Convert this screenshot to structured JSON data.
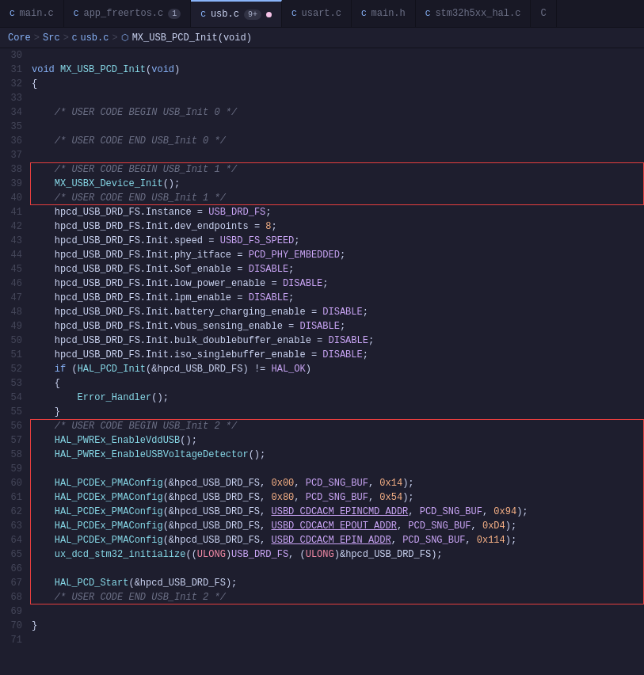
{
  "tabs": [
    {
      "id": "main-c",
      "label": "main.c",
      "icon": "C",
      "active": false,
      "badge": null,
      "dot": false
    },
    {
      "id": "app-freertos-c",
      "label": "app_freertos.c",
      "icon": "C",
      "active": false,
      "badge": "1",
      "dot": false
    },
    {
      "id": "usb-c",
      "label": "usb.c",
      "icon": "C",
      "active": true,
      "badge": "9+",
      "dot": true
    },
    {
      "id": "usart-c",
      "label": "usart.c",
      "icon": "C",
      "active": false,
      "badge": null,
      "dot": false
    },
    {
      "id": "main-h",
      "label": "main.h",
      "icon": "C",
      "active": false,
      "badge": null,
      "dot": false
    },
    {
      "id": "stm32h5xx-hal-c",
      "label": "stm32h5xx_hal.c",
      "icon": "C",
      "active": false,
      "badge": null,
      "dot": false
    }
  ],
  "breadcrumb": {
    "parts": [
      "Core",
      "Src",
      "usb.c",
      "MX_USB_PCD_Init(void)"
    ]
  },
  "lines": [
    {
      "num": 30,
      "content": ""
    },
    {
      "num": 31,
      "content": "void MX_USB_PCD_Init(void)",
      "block": 0
    },
    {
      "num": 32,
      "content": "{",
      "block": 0
    },
    {
      "num": 33,
      "content": "",
      "block": 0
    },
    {
      "num": 34,
      "content": "    /* USER CODE BEGIN USB_Init 0 */",
      "block": 0
    },
    {
      "num": 35,
      "content": "",
      "block": 0
    },
    {
      "num": 36,
      "content": "    /* USER CODE END USB_Init 0 */",
      "block": 0
    },
    {
      "num": 37,
      "content": "",
      "block": 0
    },
    {
      "num": 38,
      "content": "    /* USER CODE BEGIN USB_Init 1 */",
      "block": 1
    },
    {
      "num": 39,
      "content": "    MX_USBX_Device_Init();",
      "block": 1
    },
    {
      "num": 40,
      "content": "    /* USER CODE END USB_Init 1 */",
      "block": 1
    },
    {
      "num": 41,
      "content": "    hpcd_USB_DRD_FS.Instance = USB_DRD_FS;",
      "block": 0
    },
    {
      "num": 42,
      "content": "    hpcd_USB_DRD_FS.Init.dev_endpoints = 8;",
      "block": 0
    },
    {
      "num": 43,
      "content": "    hpcd_USB_DRD_FS.Init.speed = USBD_FS_SPEED;",
      "block": 0
    },
    {
      "num": 44,
      "content": "    hpcd_USB_DRD_FS.Init.phy_itface = PCD_PHY_EMBEDDED;",
      "block": 0
    },
    {
      "num": 45,
      "content": "    hpcd_USB_DRD_FS.Init.Sof_enable = DISABLE;",
      "block": 0
    },
    {
      "num": 46,
      "content": "    hpcd_USB_DRD_FS.Init.low_power_enable = DISABLE;",
      "block": 0
    },
    {
      "num": 47,
      "content": "    hpcd_USB_DRD_FS.Init.lpm_enable = DISABLE;",
      "block": 0
    },
    {
      "num": 48,
      "content": "    hpcd_USB_DRD_FS.Init.battery_charging_enable = DISABLE;",
      "block": 0
    },
    {
      "num": 49,
      "content": "    hpcd_USB_DRD_FS.Init.vbus_sensing_enable = DISABLE;",
      "block": 0
    },
    {
      "num": 50,
      "content": "    hpcd_USB_DRD_FS.Init.bulk_doublebuffer_enable = DISABLE;",
      "block": 0
    },
    {
      "num": 51,
      "content": "    hpcd_USB_DRD_FS.Init.iso_singlebuffer_enable = DISABLE;",
      "block": 0
    },
    {
      "num": 52,
      "content": "    if (HAL_PCD_Init(&hpcd_USB_DRD_FS) != HAL_OK)",
      "block": 0
    },
    {
      "num": 53,
      "content": "    {",
      "block": 0
    },
    {
      "num": 54,
      "content": "        Error_Handler();",
      "block": 0
    },
    {
      "num": 55,
      "content": "    }",
      "block": 0
    },
    {
      "num": 56,
      "content": "    /* USER CODE BEGIN USB_Init 2 */",
      "block": 2
    },
    {
      "num": 57,
      "content": "    HAL_PWREx_EnableVddUSB();",
      "block": 2
    },
    {
      "num": 58,
      "content": "    HAL_PWREx_EnableUSBVoltageDetector();",
      "block": 2
    },
    {
      "num": 59,
      "content": "",
      "block": 2
    },
    {
      "num": 60,
      "content": "    HAL_PCDEx_PMAConfig(&hpcd_USB_DRD_FS, 0x00, PCD_SNG_BUF, 0x14);",
      "block": 2
    },
    {
      "num": 61,
      "content": "    HAL_PCDEx_PMAConfig(&hpcd_USB_DRD_FS, 0x80, PCD_SNG_BUF, 0x54);",
      "block": 2
    },
    {
      "num": 62,
      "content": "    HAL_PCDEx_PMAConfig(&hpcd_USB_DRD_FS, USBD_CDCACM_EPINCMD_ADDR, PCD_SNG_BUF, 0x94);",
      "block": 2
    },
    {
      "num": 63,
      "content": "    HAL_PCDEx_PMAConfig(&hpcd_USB_DRD_FS, USBD_CDCACM_EPOUT_ADDR, PCD_SNG_BUF, 0xD4);",
      "block": 2
    },
    {
      "num": 64,
      "content": "    HAL_PCDEx_PMAConfig(&hpcd_USB_DRD_FS, USBD_CDCACM_EPIN_ADDR, PCD_SNG_BUF, 0x114);",
      "block": 2
    },
    {
      "num": 65,
      "content": "    ux_dcd_stm32_initialize((ULONG)USB_DRD_FS, (ULONG)&hpcd_USB_DRD_FS);",
      "block": 2
    },
    {
      "num": 66,
      "content": "",
      "block": 2
    },
    {
      "num": 67,
      "content": "    HAL_PCD_Start(&hpcd_USB_DRD_FS);",
      "block": 2
    },
    {
      "num": 68,
      "content": "    /* USER CODE END USB_Init 2 */",
      "block": 2
    },
    {
      "num": 69,
      "content": "",
      "block": 0
    },
    {
      "num": 70,
      "content": "}",
      "block": 0
    },
    {
      "num": 71,
      "content": "",
      "block": 0
    }
  ]
}
